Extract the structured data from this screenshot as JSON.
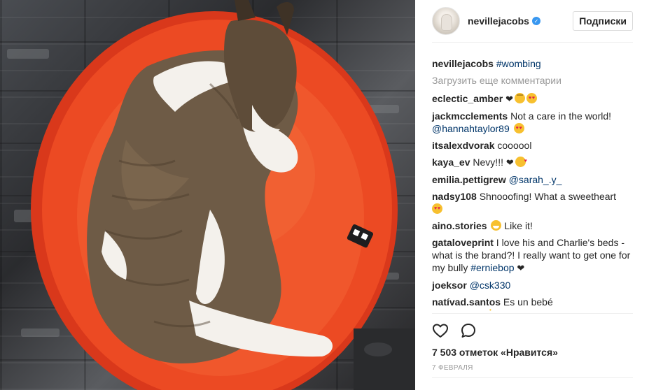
{
  "post": {
    "photo_alt": "",
    "author": {
      "username": "nevillejacobs",
      "verified": true,
      "follow_label": "Подписки"
    },
    "caption": {
      "username": "nevillejacobs",
      "hashtag": "#wombing"
    },
    "load_more_label": "Загрузить еще комментарии",
    "comments": [
      {
        "username": "eclectic_amber",
        "parts": [
          {
            "t": "heart"
          },
          {
            "t": "emoji",
            "name": "dizzy"
          },
          {
            "t": "emoji",
            "name": "hearteyes"
          }
        ]
      },
      {
        "username": "jackmcclements",
        "text": "Not a care in the world!",
        "mention": "@hannahtaylor89",
        "emoji": "hearteyes"
      },
      {
        "username": "itsalexdvorak",
        "text": "coooool"
      },
      {
        "username": "kaya_ev",
        "text": "Nevy!!!",
        "parts": [
          {
            "t": "heart"
          },
          {
            "t": "emoji",
            "name": "kiss"
          }
        ]
      },
      {
        "username": "emilia.pettigrew",
        "mention": "@sarah_.y_"
      },
      {
        "username": "nadsy108",
        "text": "Shnooofing! What a sweetheart",
        "emoji": "hearteyes"
      },
      {
        "username": "aino.stories",
        "pre_emoji": "grin",
        "text": "Like it!"
      },
      {
        "username": "gataloveprint",
        "text": "I love his and Charlie's beds - what is the brand?! I really want to get one for my bully",
        "mention": "#erniebop",
        "heart": true
      },
      {
        "username": "joeksor",
        "mention": "@csk330"
      },
      {
        "username": "natívad.santos",
        "text": "Es un bebé"
      }
    ],
    "actions": {
      "like_icon": "heart-outline-icon",
      "comment_icon": "speech-bubble-icon"
    },
    "likes_text": "7 503 отметок «Нравится»",
    "date_text": "7 ФЕВРАЛЯ",
    "colors": {
      "link": "#003569",
      "muted": "#999999",
      "verified": "#3897f0",
      "bed": "#e8401c"
    }
  }
}
